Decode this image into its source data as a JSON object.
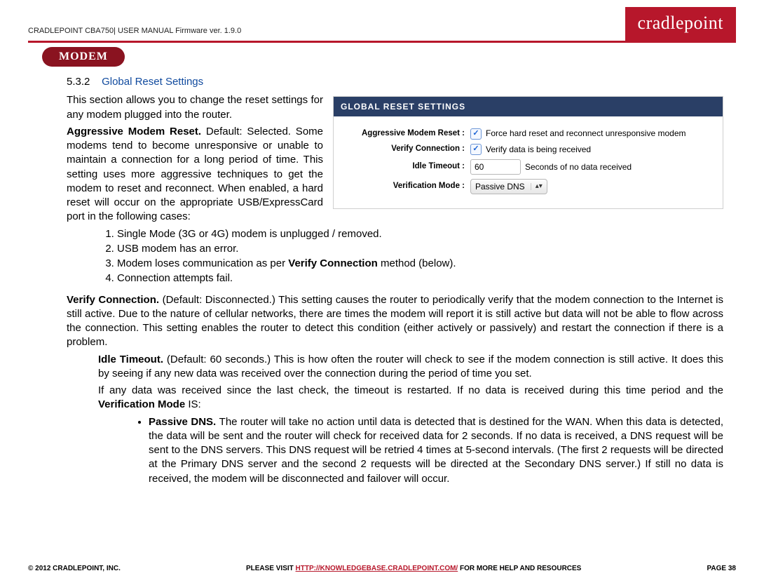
{
  "header": {
    "doc_label": "CRADLEPOINT CBA750| USER MANUAL Firmware ver. 1.9.0",
    "logo_text": "cradlepoint",
    "pill": "MODEM"
  },
  "section": {
    "number": "5.3.2",
    "title": "Global Reset Settings"
  },
  "figure": {
    "title": "GLOBAL RESET SETTINGS",
    "rows": {
      "aggressive": {
        "label": "Aggressive Modem Reset :",
        "desc": "Force hard reset and reconnect unresponsive modem"
      },
      "verify": {
        "label": "Verify Connection :",
        "desc": "Verify data is being received"
      },
      "idle": {
        "label": "Idle Timeout :",
        "value": "60",
        "desc": "Seconds of no data received"
      },
      "mode": {
        "label": "Verification Mode :",
        "value": "Passive DNS"
      }
    }
  },
  "body": {
    "p1": "This section allows you to change the reset settings for any modem plugged into the router.",
    "p2a": "Aggressive Modem Reset. ",
    "p2b": "Default: Selected. Some modems tend to become unresponsive or unable to maintain a connection for a long period of time. This setting uses more aggressive techniques to get the modem to reset and reconnect. When enabled, a hard reset will occur on the appropriate USB/ExpressCard port in the following cases:",
    "li1": "Single Mode (3G or 4G) modem is unplugged / removed.",
    "li2": "USB modem has an error.",
    "li3a": "Modem loses communication as per ",
    "li3b": "Verify Connection",
    "li3c": " method (below).",
    "li4": "Connection attempts fail.",
    "p3a": "Verify Connection. ",
    "p3b": "(Default: Disconnected.) This setting causes the router to periodically verify that the modem connection to the Internet is still active. Due to the nature of cellular networks, there are times the modem will report it is still active but data will not be able to flow across the connection. This setting enables the router to detect this condition (either actively or passively) and restart the connection if there is a problem.",
    "p4a": "Idle Timeout. ",
    "p4b": "(Default: 60 seconds.) This is how often the router will check to see if the modem connection is still active. It does this by seeing if any new data was received over the connection during the period of time you set.",
    "p5a": "If any data was received since the last check, the timeout is restarted. If no data is received during this time period and the ",
    "p5b": "Verification Mode",
    "p5c": " IS:",
    "p6a": "Passive DNS. ",
    "p6b": "The router will take no action until data is detected that is destined for the WAN. When this data is detected, the data will be sent and the router will check for received data for 2 seconds. If no data is received, a DNS request will be sent to the DNS servers. This DNS request will be retried 4 times at 5-second intervals. (The first 2 requests will be directed at the Primary DNS server and the second 2 requests will be directed at the Secondary DNS server.) If still no data is received, the modem will be disconnected and failover will occur."
  },
  "footer": {
    "left": "© 2012 CRADLEPOINT, INC.",
    "mid_pre": "PLEASE VISIT ",
    "mid_link": "HTTP://KNOWLEDGEBASE.CRADLEPOINT.COM/",
    "mid_post": " FOR MORE HELP AND RESOURCES",
    "right": "PAGE 38"
  }
}
